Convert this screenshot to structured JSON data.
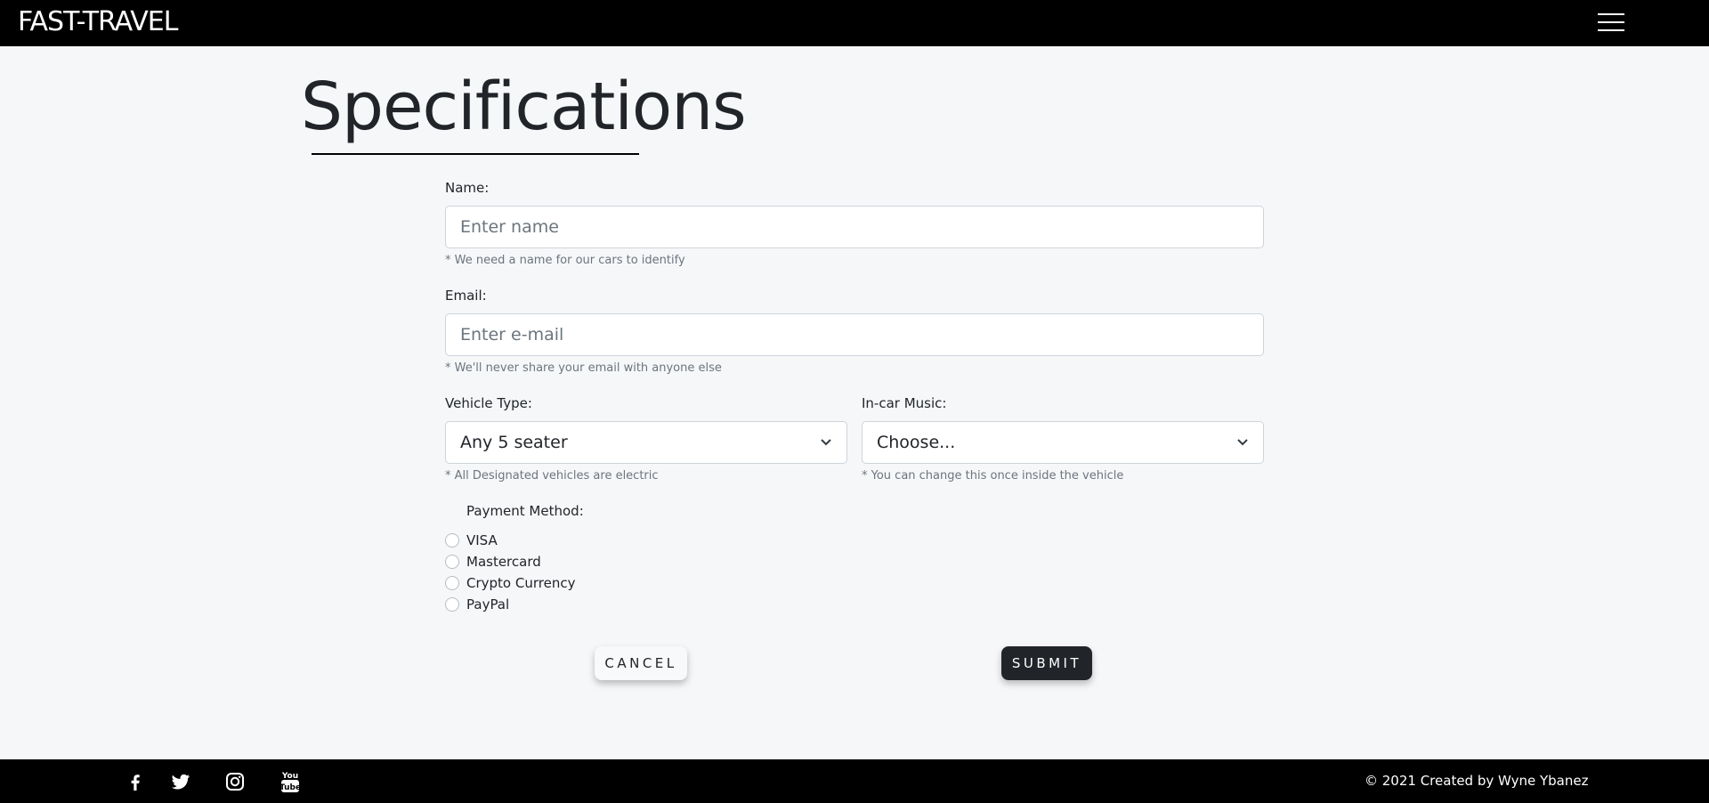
{
  "navbar": {
    "brand": "FAST-TRAVEL",
    "menu_icon": "hamburger-icon"
  },
  "page": {
    "title": "Specifications"
  },
  "form": {
    "name": {
      "label": "Name:",
      "value": "",
      "placeholder": "Enter name",
      "hint": "* We need a name for our cars to identify"
    },
    "email": {
      "label": "Email:",
      "value": "",
      "placeholder": "Enter e-mail",
      "hint": "* We'll never share your email with anyone else"
    },
    "vehicle_type": {
      "label": "Vehicle Type:",
      "selected": "Any 5 seater",
      "hint": "* All Designated vehicles are electric"
    },
    "music": {
      "label": "In-car Music:",
      "selected": "Choose...",
      "hint": "* You can change this once inside the vehicle"
    },
    "payment": {
      "label": "Payment Method:",
      "options": [
        {
          "label": "VISA",
          "checked": false
        },
        {
          "label": "Mastercard",
          "checked": false
        },
        {
          "label": "Crypto Currency",
          "checked": false
        },
        {
          "label": "PayPal",
          "checked": false
        }
      ]
    },
    "cancel_label": "CANCEL",
    "submit_label": "SUBMIT"
  },
  "footer": {
    "social": [
      "facebook-icon",
      "twitter-icon",
      "instagram-icon",
      "youtube-icon"
    ],
    "copyright": "© 2021 Created by Wyne Ybanez"
  }
}
